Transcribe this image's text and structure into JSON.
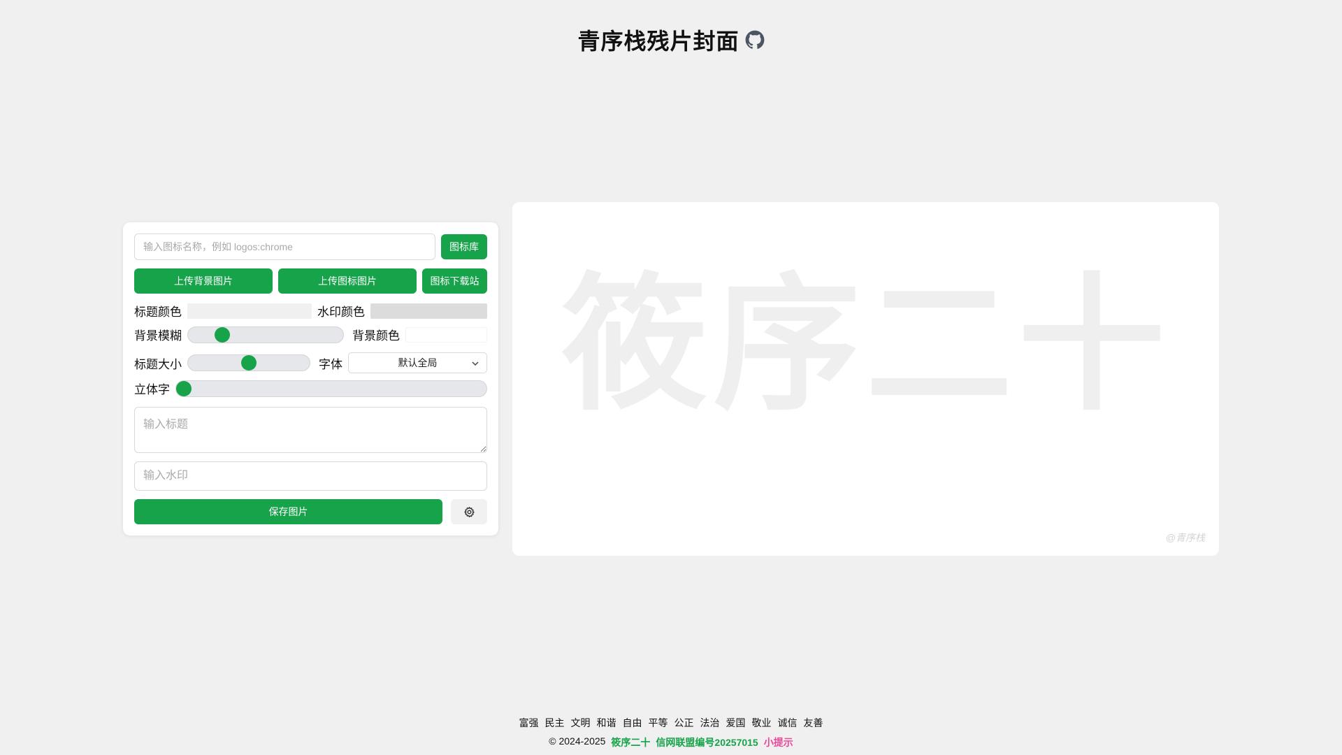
{
  "header": {
    "title": "青序栈残片封面",
    "github_icon": "github-icon"
  },
  "controls": {
    "icon_input_placeholder": "输入图标名称，例如 logos:chrome",
    "icon_lib_button": "图标库",
    "upload_bg_button": "上传背景图片",
    "upload_icon_button": "上传图标图片",
    "icon_download_button": "图标下载站",
    "title_color_label": "标题颜色",
    "title_color_value": "#f0f0f0",
    "watermark_color_label": "水印颜色",
    "watermark_color_value": "#dcdcdc",
    "bg_blur_label": "背景模糊",
    "bg_blur_value": 0.19,
    "bg_color_label": "背景颜色",
    "bg_color_value": "#ffffff",
    "title_size_label": "标题大小",
    "title_size_value": 0.5,
    "font_label": "字体",
    "font_selected": "默认全局",
    "three_d_label": "立体字",
    "three_d_value": 0,
    "title_placeholder": "输入标题",
    "watermark_placeholder": "输入水印",
    "save_button": "保存图片",
    "settings_icon": "gear-icon"
  },
  "preview": {
    "title_text": "筱序二十",
    "watermark_text": "@青序栈"
  },
  "footer": {
    "values": [
      "富强",
      "民主",
      "文明",
      "和谐",
      "自由",
      "平等",
      "公正",
      "法治",
      "爱国",
      "敬业",
      "诚信",
      "友善"
    ],
    "copyright": "© 2024-2025",
    "author": "筱序二十",
    "license": "信网联盟编号20257015",
    "tip": "小提示"
  },
  "colors": {
    "accent": "#16a34a",
    "tip": "#ec4899",
    "page_bg": "#f0f0f0"
  }
}
